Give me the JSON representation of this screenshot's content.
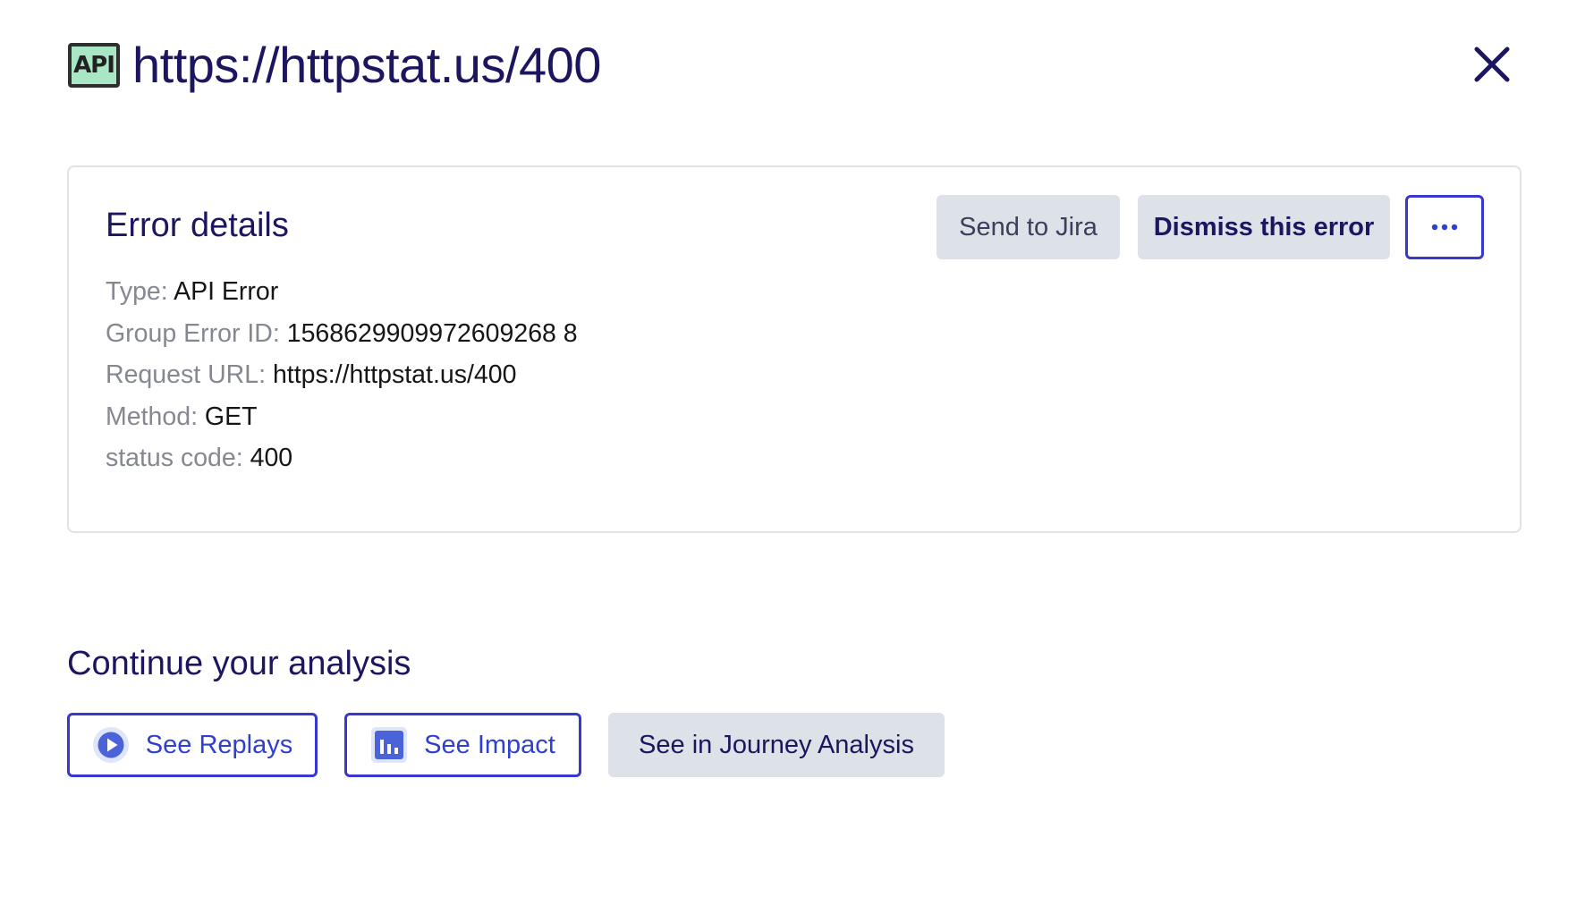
{
  "header": {
    "icon": "api-icon",
    "icon_text": "API",
    "title": "https://httpstat.us/400",
    "close_icon": "close-icon"
  },
  "error_card": {
    "title": "Error details",
    "actions": {
      "send_to_jira": "Send to Jira",
      "dismiss": "Dismiss this error",
      "more_icon": "more-horizontal-icon"
    },
    "details": [
      {
        "key": "Type",
        "value": "API Error"
      },
      {
        "key": "Group Error ID",
        "value": "1568629909972609268 8"
      },
      {
        "key": "Request URL",
        "value": "https://httpstat.us/400"
      },
      {
        "key": "Method",
        "value": "GET"
      },
      {
        "key": "status code",
        "value": "400"
      }
    ]
  },
  "continue": {
    "title": "Continue your analysis",
    "buttons": {
      "replays": "See Replays",
      "impact": "See Impact",
      "journey": "See in Journey Analysis"
    }
  },
  "colors": {
    "title": "#1c1660",
    "accent": "#3838d0",
    "button_gray": "#dde1e8",
    "api_icon_bg": "#a8e6c4"
  }
}
